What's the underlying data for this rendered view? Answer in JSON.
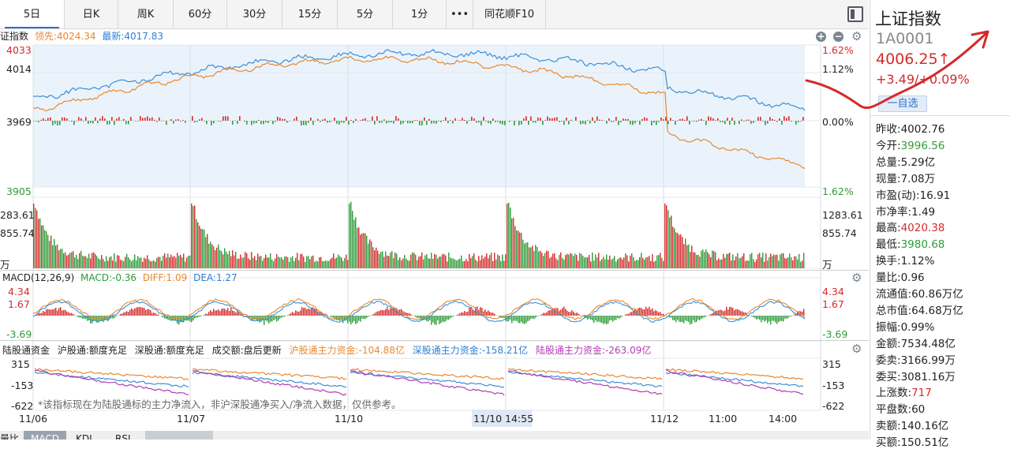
{
  "tabs": [
    "5日",
    "日K",
    "周K",
    "60分",
    "30分",
    "15分",
    "5分",
    "1分",
    "•••",
    "同花顺F10"
  ],
  "price_chart": {
    "index_name": "证指数",
    "leading_label": "领先:4024.34",
    "latest_label": "最新:4017.83",
    "left_axis": [
      "4033",
      "4014",
      "3969",
      "3905"
    ],
    "right_axis": [
      "1.62%",
      "1.12%",
      "0.00%",
      "1.62%"
    ]
  },
  "volume_chart": {
    "left_axis": [
      "283.61",
      "855.74",
      "万"
    ],
    "right_axis": [
      "1283.61",
      "855.74",
      "万"
    ]
  },
  "macd": {
    "title": "MACD(12,26,9)",
    "macd_label": "MACD:-0.36",
    "diff_label": "DIFF:1.09",
    "dea_label": "DEA:1.27",
    "left_axis": [
      "4.34",
      "1.67",
      "-3.69"
    ],
    "right_axis": [
      "4.34",
      "1.67",
      "-3.69"
    ]
  },
  "northbound": {
    "title": "陆股通资金",
    "sh_status": "沪股通:额度充足",
    "sz_status": "深股通:额度充足",
    "turnover_status": "成交额:盘后更新",
    "sh_flow": "沪股通主力资金:-104.88亿",
    "sz_flow": "深股通主力资金:-158.21亿",
    "total_flow": "陆股通主力资金:-263.09亿",
    "left_axis": [
      "315",
      "-153",
      "-622"
    ],
    "right_axis": [
      "315",
      "-153",
      "-622"
    ],
    "note": "*该指标现在为陆股通标的主力净流入，非沪深股通净买入/净流入数据，仅供参考。"
  },
  "date_axis": [
    "11/06",
    "11/07",
    "11/10",
    "11/10 14:55",
    "11/12",
    "11:00",
    "14:00"
  ],
  "bottom_tabs": [
    "量比",
    "MACD",
    "KDJ",
    "RSI"
  ],
  "quote": {
    "name": "上证指数",
    "code": "1A0001",
    "price": "4006.25↑",
    "change": "+3.49/+0.09%",
    "watch_button": "一自选"
  },
  "stats": [
    {
      "label": "昨收:",
      "value": "4002.76",
      "color": "black"
    },
    {
      "label": "今开:",
      "value": "3996.56",
      "color": "green"
    },
    {
      "label": "总量:",
      "value": "5.29亿",
      "color": "black"
    },
    {
      "label": "现量:",
      "value": "7.08万",
      "color": "black"
    },
    {
      "label": "市盈(动):",
      "value": "16.91",
      "color": "black"
    },
    {
      "label": "市净率:",
      "value": "1.49",
      "color": "black"
    },
    {
      "label": "最高:",
      "value": "4020.38",
      "color": "red"
    },
    {
      "label": "最低:",
      "value": "3980.68",
      "color": "green"
    },
    {
      "label": "换手:",
      "value": "1.12%",
      "color": "black"
    },
    {
      "label": "量比:",
      "value": "0.96",
      "color": "black"
    },
    {
      "label": "流通值:",
      "value": "60.86万亿",
      "color": "black"
    },
    {
      "label": "总市值:",
      "value": "64.68万亿",
      "color": "black"
    },
    {
      "label": "振幅:",
      "value": "0.99%",
      "color": "black"
    },
    {
      "label": "金额:",
      "value": "7534.48亿",
      "color": "black"
    },
    {
      "label": "委卖:",
      "value": "3166.99万",
      "color": "black"
    },
    {
      "label": "委买:",
      "value": "3081.16万",
      "color": "black"
    },
    {
      "label": "上涨数:",
      "value": "717",
      "color": "red"
    },
    {
      "label": "平盘数:",
      "value": "60",
      "color": "black"
    },
    {
      "label": "卖额:",
      "value": "140.16亿",
      "color": "black"
    },
    {
      "label": "买额:",
      "value": "150.51亿",
      "color": "black"
    }
  ],
  "colors": {
    "up": "#d62b2b",
    "down": "#2f9c3a",
    "latest_line": "#3d8fd6",
    "leading_line": "#e8892f",
    "accent": "#2b6fd0",
    "annotation": "#d42a2a"
  }
}
